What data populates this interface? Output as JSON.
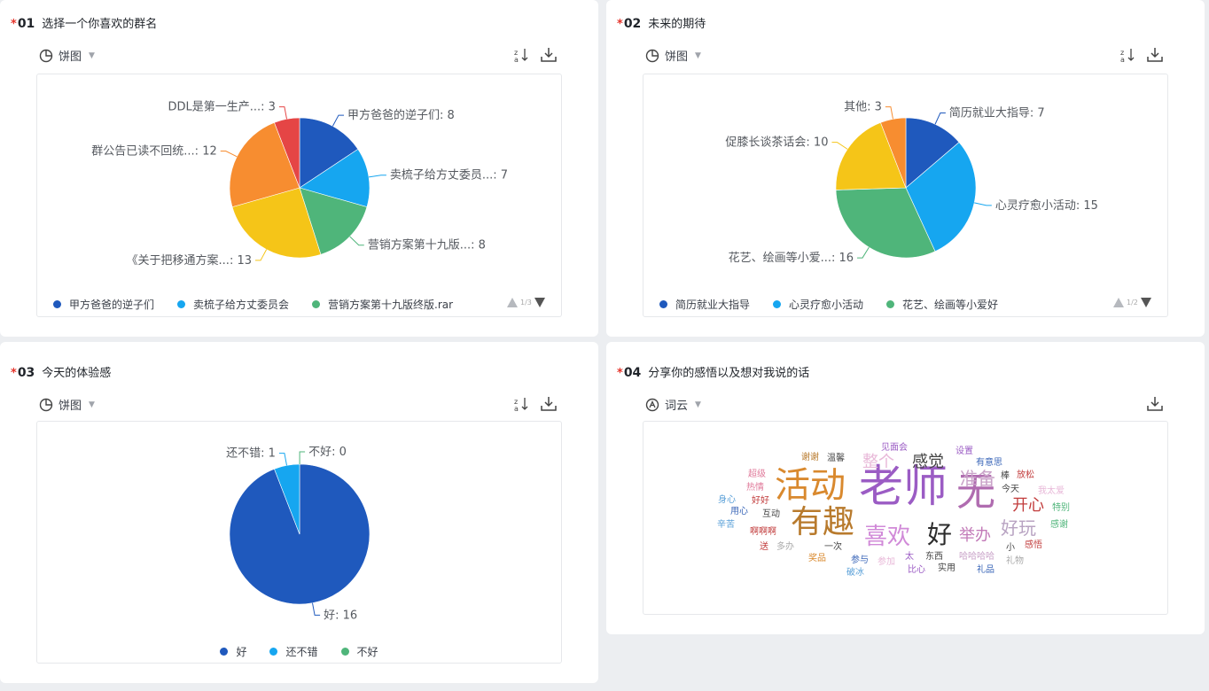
{
  "cards": [
    {
      "star": "*",
      "number": "01",
      "question": "选择一个你喜欢的群名",
      "chart_type_label": "饼图",
      "pager": "1/3",
      "legend": [
        {
          "label": "甲方爸爸的逆子们",
          "color": "#1f59bd"
        },
        {
          "label": "卖梳子给方丈委员会",
          "color": "#16a6f0"
        },
        {
          "label": "营销方案第十九版终版.rar",
          "color": "#4fb57a"
        }
      ]
    },
    {
      "star": "*",
      "number": "02",
      "question": "未来的期待",
      "chart_type_label": "饼图",
      "pager": "1/2",
      "legend": [
        {
          "label": "简历就业大指导",
          "color": "#1f59bd"
        },
        {
          "label": "心灵疗愈小活动",
          "color": "#16a6f0"
        },
        {
          "label": "花艺、绘画等小爱好",
          "color": "#4fb57a"
        }
      ]
    },
    {
      "star": "*",
      "number": "03",
      "question": "今天的体验感",
      "chart_type_label": "饼图",
      "legend": [
        {
          "label": "好",
          "color": "#1f59bd"
        },
        {
          "label": "还不错",
          "color": "#16a6f0"
        },
        {
          "label": "不好",
          "color": "#4fb57a"
        }
      ]
    },
    {
      "star": "*",
      "number": "04",
      "question": "分享你的感悟以及想对我说的话",
      "chart_type_label": "词云"
    }
  ],
  "chart_data": [
    {
      "type": "pie",
      "slices": [
        {
          "label": "甲方爸爸的逆子们: 8",
          "value": 8,
          "color": "#1f59bd"
        },
        {
          "label": "卖梳子给方丈委员...: 7",
          "value": 7,
          "color": "#16a6f0"
        },
        {
          "label": "营销方案第十九版...: 8",
          "value": 8,
          "color": "#4fb57a"
        },
        {
          "label": "《关于把移通方案...: 13",
          "value": 13,
          "color": "#f5c518"
        },
        {
          "label": "群公告已读不回统...: 12",
          "value": 12,
          "color": "#f78d30"
        },
        {
          "label": "DDL是第一生产...: 3",
          "value": 3,
          "color": "#e54545"
        }
      ]
    },
    {
      "type": "pie",
      "slices": [
        {
          "label": "简历就业大指导: 7",
          "value": 7,
          "color": "#1f59bd"
        },
        {
          "label": "心灵疗愈小活动: 15",
          "value": 15,
          "color": "#16a6f0"
        },
        {
          "label": "花艺、绘画等小爱...: 16",
          "value": 16,
          "color": "#4fb57a"
        },
        {
          "label": "促膝长谈茶话会: 10",
          "value": 10,
          "color": "#f5c518"
        },
        {
          "label": "其他: 3",
          "value": 3,
          "color": "#f78d30"
        }
      ]
    },
    {
      "type": "pie",
      "slices": [
        {
          "label": "好: 16",
          "value": 16,
          "color": "#1f59bd"
        },
        {
          "label": "还不错: 1",
          "value": 1,
          "color": "#16a6f0"
        },
        {
          "label": "不好: 0",
          "value": 0,
          "color": "#4fb57a"
        }
      ]
    }
  ],
  "wordcloud": [
    {
      "text": "老师",
      "color": "#9b5cc4"
    },
    {
      "text": "无",
      "color": "#b06cb0"
    },
    {
      "text": "活动",
      "color": "#d9892e"
    },
    {
      "text": "有趣",
      "color": "#b87a2c"
    },
    {
      "text": "喜欢",
      "color": "#d18ad8"
    },
    {
      "text": "好",
      "color": "#2c2c2c"
    },
    {
      "text": "整个",
      "color": "#e8b8d8"
    },
    {
      "text": "感觉",
      "color": "#444444"
    },
    {
      "text": "准备",
      "color": "#c9a2c8"
    },
    {
      "text": "开心",
      "color": "#c23d3d"
    },
    {
      "text": "举办",
      "color": "#c27ab8"
    },
    {
      "text": "好玩",
      "color": "#b8a3c2"
    },
    {
      "text": "谢谢",
      "color": "#b87a2c"
    },
    {
      "text": "温馨",
      "color": "#444444"
    },
    {
      "text": "见面会",
      "color": "#9b5cc4"
    },
    {
      "text": "设置",
      "color": "#9b5cc4"
    },
    {
      "text": "有意思",
      "color": "#3a66b8"
    },
    {
      "text": "超级",
      "color": "#e07b9b"
    },
    {
      "text": "热情",
      "color": "#e07b9b"
    },
    {
      "text": "身心",
      "color": "#5aa0d8"
    },
    {
      "text": "好好",
      "color": "#c23d3d"
    },
    {
      "text": "用心",
      "color": "#3a66b8"
    },
    {
      "text": "互动",
      "color": "#444444"
    },
    {
      "text": "辛苦",
      "color": "#5aa0d8"
    },
    {
      "text": "啊啊啊",
      "color": "#c23d3d"
    },
    {
      "text": "送",
      "color": "#c23d3d"
    },
    {
      "text": "多办",
      "color": "#aaaaaa"
    },
    {
      "text": "一次",
      "color": "#444444"
    },
    {
      "text": "奖品",
      "color": "#d9892e"
    },
    {
      "text": "参与",
      "color": "#3a66b8"
    },
    {
      "text": "参加",
      "color": "#e8b8d8"
    },
    {
      "text": "太",
      "color": "#9b5cc4"
    },
    {
      "text": "东西",
      "color": "#444444"
    },
    {
      "text": "哈哈哈哈",
      "color": "#c9a2c8"
    },
    {
      "text": "破冰",
      "color": "#5aa0d8"
    },
    {
      "text": "比心",
      "color": "#9b5cc4"
    },
    {
      "text": "实用",
      "color": "#444444"
    },
    {
      "text": "礼品",
      "color": "#3a66b8"
    },
    {
      "text": "礼物",
      "color": "#aaaaaa"
    },
    {
      "text": "棒",
      "color": "#444444"
    },
    {
      "text": "放松",
      "color": "#c23d3d"
    },
    {
      "text": "今天",
      "color": "#444444"
    },
    {
      "text": "我太爱",
      "color": "#e8b8d8"
    },
    {
      "text": "特别",
      "color": "#4fb57a"
    },
    {
      "text": "小",
      "color": "#444444"
    },
    {
      "text": "感悟",
      "color": "#c23d3d"
    },
    {
      "text": "感谢",
      "color": "#4fb57a"
    }
  ]
}
